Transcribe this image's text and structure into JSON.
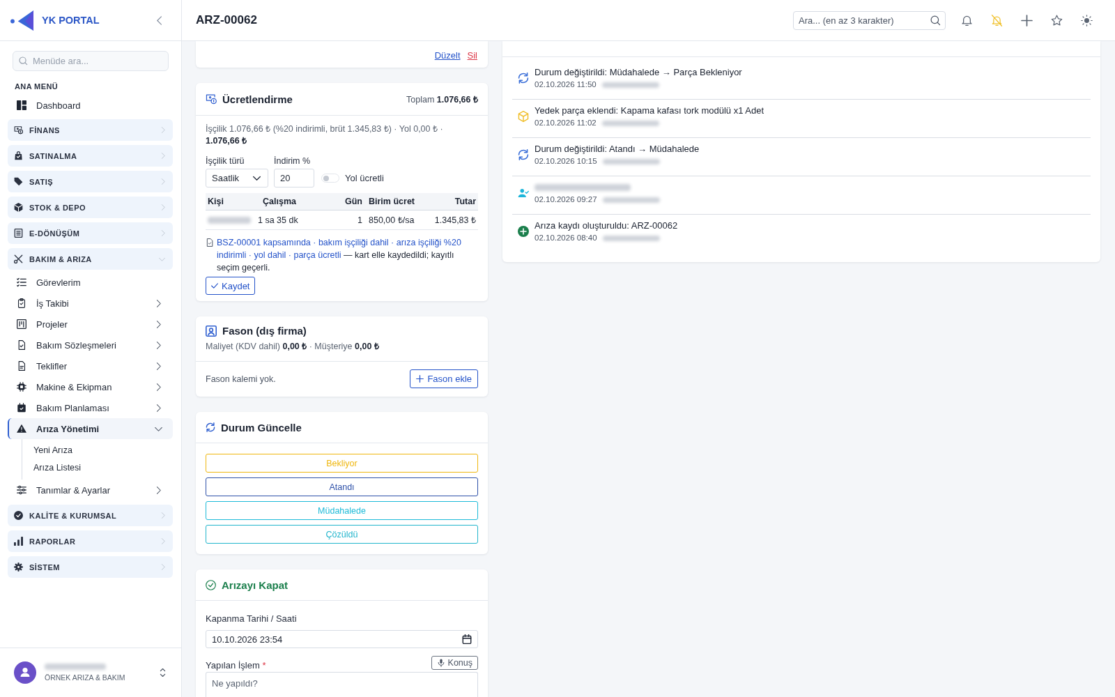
{
  "sidebar": {
    "brand": "YK PORTAL",
    "search_placeholder": "Menüde ara...",
    "section_label": "ANA MENÜ",
    "items": [
      {
        "kind": "link",
        "label": "Dashboard",
        "selected": false
      },
      {
        "kind": "group",
        "label": "FİNANS",
        "expanded": false
      },
      {
        "kind": "group",
        "label": "SATINALMA",
        "expanded": false
      },
      {
        "kind": "group",
        "label": "SATIŞ",
        "expanded": false
      },
      {
        "kind": "group",
        "label": "STOK & DEPO",
        "expanded": false
      },
      {
        "kind": "group",
        "label": "E-DÖNÜŞÜM",
        "expanded": false
      },
      {
        "kind": "group",
        "label": "BAKIM & ARIZA",
        "expanded": true,
        "children": [
          {
            "label": "Görevlerim",
            "selected": false
          },
          {
            "label": "İş Takibi",
            "selected": false,
            "expanded": false
          },
          {
            "label": "Projeler",
            "selected": false,
            "expanded": false
          },
          {
            "label": "Bakım Sözleşmeleri",
            "selected": false,
            "expanded": false
          },
          {
            "label": "Teklifler",
            "selected": false,
            "expanded": false
          },
          {
            "label": "Makine & Ekipman",
            "selected": false,
            "expanded": false
          },
          {
            "label": "Bakım Planlaması",
            "selected": false,
            "expanded": false
          },
          {
            "label": "Arıza Yönetimi",
            "selected": true,
            "expanded": true,
            "children": [
              {
                "label": "Yeni Arıza",
                "selected": false
              },
              {
                "label": "Arıza Listesi",
                "selected": false
              }
            ]
          },
          {
            "label": "Tanımlar & Ayarlar",
            "selected": false,
            "expanded": false
          }
        ]
      },
      {
        "kind": "group",
        "label": "KALİTE & KURUMSAL",
        "expanded": false
      },
      {
        "kind": "group",
        "label": "RAPORLAR",
        "expanded": false
      },
      {
        "kind": "group",
        "label": "SİSTEM",
        "expanded": false
      }
    ]
  },
  "user": {
    "name_blurred": true,
    "org": "ÖRNEK ARIZA & BAKIM"
  },
  "header": {
    "title": "ARZ-00062",
    "search_placeholder": "Ara... (en az 3 karakter)",
    "do_not_disturb": true
  },
  "entry_card": {
    "links": [
      {
        "kind": "edit",
        "label": "Düzelt"
      },
      {
        "kind": "delete",
        "label": "Sil"
      }
    ]
  },
  "pricing": {
    "title": "Ücretlendirme",
    "total_label": "Toplam",
    "total": "1.076,66 ₺",
    "summary": "İşçilik 1.076,66 ₺ (%20 indirimli, brüt 1.345,83 ₺) · Yol 0,00 ₺ · **1.076,66 ₺**",
    "labor_type": {
      "label": "İşçilik türü",
      "value": "Saatlik"
    },
    "discount": {
      "label": "İndirim %",
      "value": "20"
    },
    "road_paid": {
      "label": "Yol ücretli",
      "on": false
    },
    "table": {
      "columns": [
        "Kişi",
        "Çalışma",
        "Gün",
        "Birim ücret",
        "Tutar"
      ],
      "rows": [
        {
          "person_blurred": true,
          "work": "1 sa 35 dk",
          "days": "1",
          "unit_price": "850,00 ₺/sa",
          "amount": "1.345,83 ₺"
        }
      ]
    },
    "note": {
      "highlight": "BSZ-00001 kapsamında · bakım işçiliği dahil · arıza işçiliği %20 indirimli · yol dahil · parça ücretli",
      "rest": "— kart elle kaydedildi; kayıtlı seçim geçerli."
    },
    "save_button": "Kaydet"
  },
  "subcontract": {
    "title": "Fason (dış firma)",
    "summary": "Maliyet (KDV dahil) **0,00 ₺** · Müşteriye **0,00 ₺**",
    "empty_text": "Fason kalemi yok.",
    "add_button": "Fason ekle"
  },
  "status_update": {
    "title": "Durum Güncelle",
    "options": [
      {
        "label": "Bekliyor",
        "color": "#efb70f"
      },
      {
        "label": "Atandı",
        "color": "#2d50a8"
      },
      {
        "label": "Müdahalede",
        "color": "#1cbad8"
      },
      {
        "label": "Çözüldü",
        "color": "#22b5cc"
      }
    ]
  },
  "close_form": {
    "title": "Arızayı Kapat",
    "date_label": "Kapanma Tarihi / Saati",
    "date_value": "10.10.2026 23:54",
    "work_label": "Yapılan İşlem",
    "required_mark": "*",
    "dictate_button": "Konuş",
    "work_placeholder": "Ne yapıldı?"
  },
  "timeline": {
    "items": [
      {
        "kind": "status",
        "title": "Durum değiştirildi: Müdahalede → Parça Bekleniyor",
        "time": "02.10.2026 11:50",
        "author_blurred": true
      },
      {
        "kind": "part",
        "title": "Yedek parça eklendi: Kapama kafası tork modülü x1 Adet",
        "time": "02.10.2026 11:02",
        "author_blurred": true
      },
      {
        "kind": "status",
        "title": "Durum değiştirildi: Atandı → Müdahalede",
        "time": "02.10.2026 10:15",
        "author_blurred": true
      },
      {
        "kind": "assign",
        "title_blurred": true,
        "time": "02.10.2026 09:27",
        "author_blurred": true
      },
      {
        "kind": "create",
        "title": "Arıza kaydı oluşturuldu: ARZ-00062",
        "time": "02.10.2026 08:40",
        "author_blurred": true
      }
    ]
  }
}
